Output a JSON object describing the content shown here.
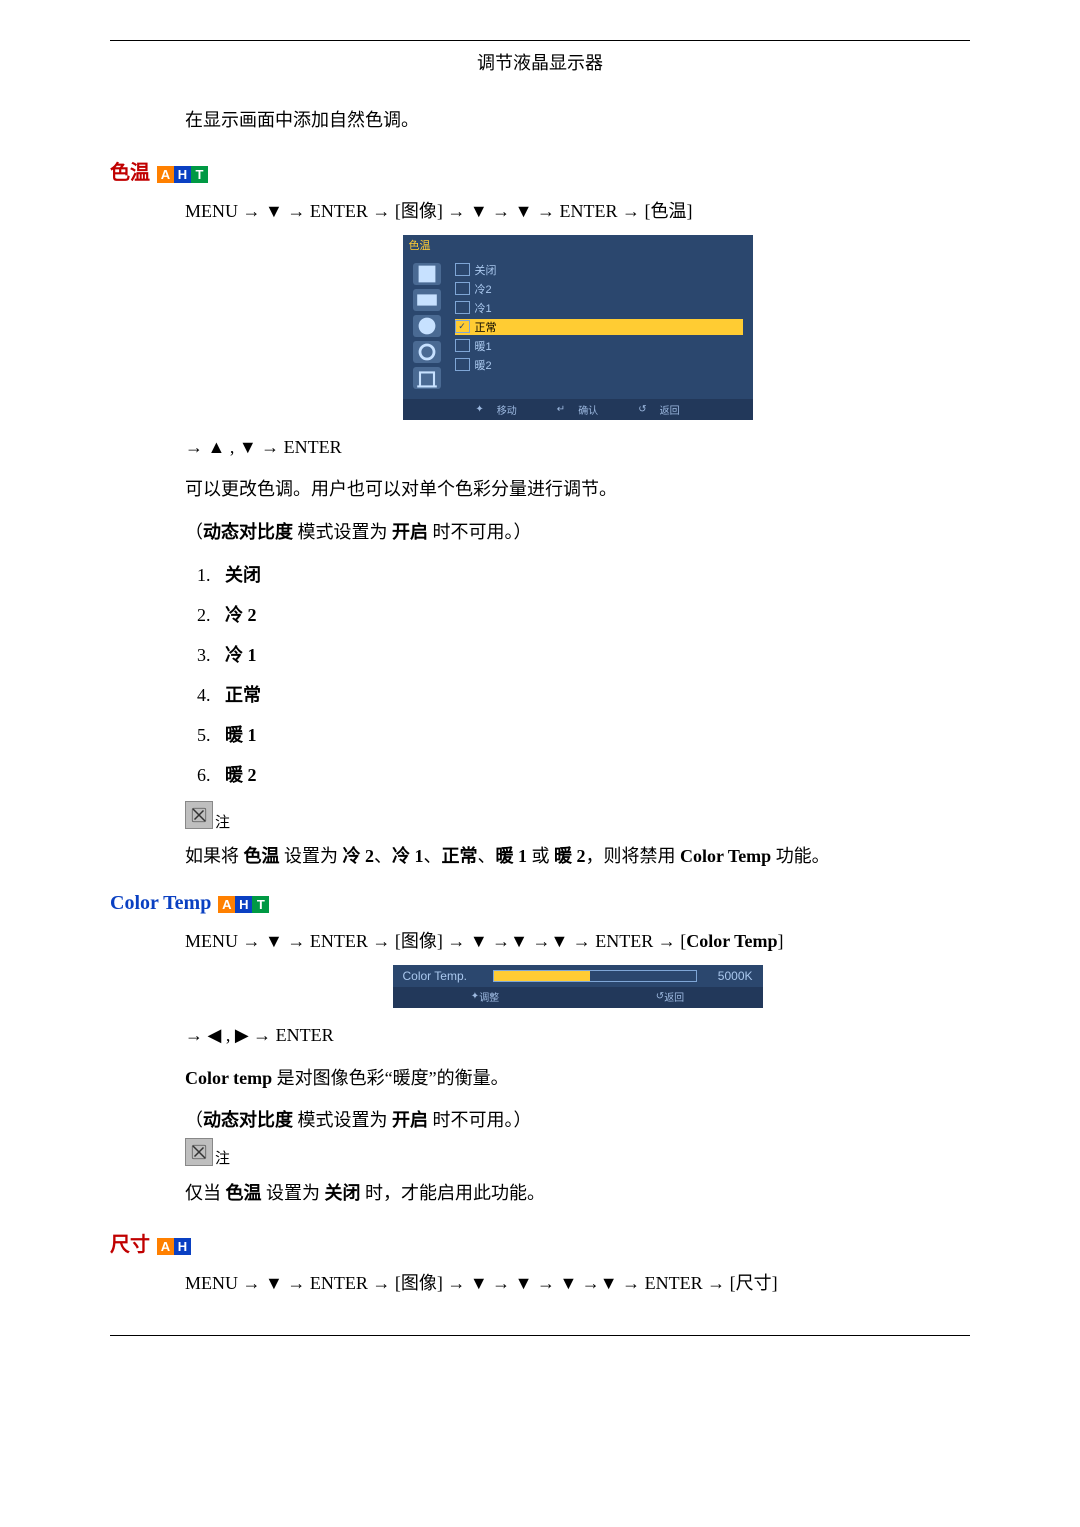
{
  "header_title": "调节液晶显示器",
  "intro_para": "在显示画面中添加自然色调。",
  "sec1": {
    "title": "色温",
    "badges": [
      "A",
      "H",
      "T"
    ],
    "path_parts": {
      "MENU": "MENU",
      "arrow": "→",
      "down": "▼",
      "ENTER": "ENTER",
      "image": "[图像]",
      "color_tone": "[色温]"
    },
    "osd_title": "色温",
    "osd_options": [
      {
        "label": "关闭",
        "checked": false,
        "selected": false
      },
      {
        "label": "冷2",
        "checked": false,
        "selected": false
      },
      {
        "label": "冷1",
        "checked": false,
        "selected": false
      },
      {
        "label": "正常",
        "checked": true,
        "selected": true
      },
      {
        "label": "暖1",
        "checked": false,
        "selected": false
      },
      {
        "label": "暖2",
        "checked": false,
        "selected": false
      }
    ],
    "osd_footer": {
      "move": "移动",
      "confirm": "确认",
      "back": "返回"
    },
    "step2": "→ ▲ , ▼ → ENTER",
    "desc": "可以更改色调。用户也可以对单个色彩分量进行调节。",
    "note_dyn_prefix": "（",
    "note_dyn_b1": "动态对比度",
    "note_dyn_mid": " 模式设置为 ",
    "note_dyn_b2": "开启",
    "note_dyn_suffix": " 时不可用。）",
    "list": [
      "关闭",
      "冷 2",
      "冷 1",
      "正常",
      "暖 1",
      "暖 2"
    ],
    "note_label": "注",
    "note_body_prefix": "如果将 ",
    "note_body_b1": "色温",
    "note_body_mid1": " 设置为 ",
    "note_body_b2": "冷 2",
    "note_body_sep": "、",
    "note_body_b3": "冷 1",
    "note_body_b4": "正常",
    "note_body_b5": "暖 1",
    "note_body_or": " 或 ",
    "note_body_b6": "暖 2",
    "note_body_mid2": "，则将禁用 ",
    "note_body_b7": "Color Temp",
    "note_body_suffix": " 功能。"
  },
  "sec2": {
    "title": "Color Temp",
    "badges": [
      "A",
      "H",
      "T"
    ],
    "path_parts": {
      "MENU": "MENU",
      "arrow": "→",
      "down": "▼",
      "ENTER": "ENTER",
      "image": "[图像]",
      "ct": "Color Temp"
    },
    "osd_label": "Color Temp.",
    "osd_value": "5000K",
    "osd_footer": {
      "adjust": "调整",
      "back": "返回"
    },
    "step2": "→ ◀ , ▶ → ENTER",
    "desc_b": "Color temp",
    "desc_rest": " 是对图像色彩“暖度”的衡量。",
    "note_dyn_prefix": "（",
    "note_dyn_b1": "动态对比度",
    "note_dyn_mid": " 模式设置为 ",
    "note_dyn_b2": "开启",
    "note_dyn_suffix": " 时不可用。）",
    "note_label": "注",
    "note_body_prefix": "仅当 ",
    "note_body_b1": "色温",
    "note_body_mid": " 设置为 ",
    "note_body_b2": "关闭",
    "note_body_suffix": " 时，才能启用此功能。"
  },
  "sec3": {
    "title": "尺寸",
    "badges": [
      "A",
      "H"
    ],
    "path_parts": {
      "MENU": "MENU",
      "arrow": "→",
      "down": "▼",
      "ENTER": "ENTER",
      "image": "[图像]",
      "size": "[尺寸]"
    }
  }
}
